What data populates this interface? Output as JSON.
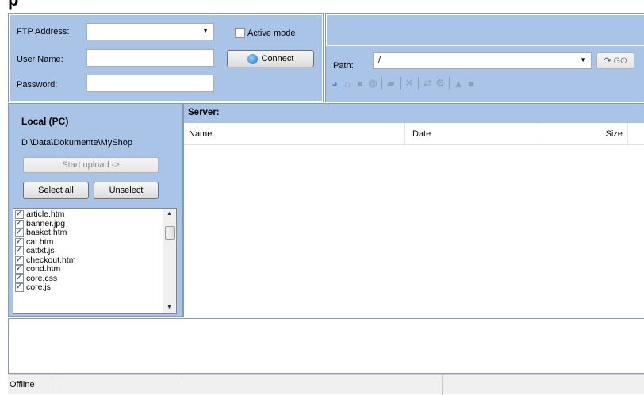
{
  "app": {
    "title_fragment": "p"
  },
  "connection": {
    "ftp_address_label": "FTP Address:",
    "ftp_address_value": "",
    "user_name_label": "User Name:",
    "user_name_value": "",
    "password_label": "Password:",
    "password_value": "",
    "active_mode_label": "Active mode",
    "active_mode_checked": false,
    "connect_label": "Connect"
  },
  "server_toolbar": {
    "path_label": "Path:",
    "path_value": "/",
    "go_label": "GO",
    "icons": [
      "connect-icon",
      "home-icon",
      "record-icon",
      "refresh-icon",
      "new-folder-icon",
      "delete-icon",
      "rename-icon",
      "permissions-icon",
      "upload-icon",
      "stop-icon"
    ]
  },
  "local": {
    "heading": "Local (PC)",
    "path": "D:\\Data\\Dokumente\\MyShop",
    "start_upload_label": "Start upload ->",
    "select_all_label": "Select all",
    "unselect_label": "Unselect",
    "files": [
      {
        "name": "article.htm",
        "checked": true
      },
      {
        "name": "banner.jpg",
        "checked": true
      },
      {
        "name": "basket.htm",
        "checked": true
      },
      {
        "name": "cat.htm",
        "checked": true
      },
      {
        "name": "cattxt.js",
        "checked": true
      },
      {
        "name": "checkout.htm",
        "checked": true
      },
      {
        "name": "cond.htm",
        "checked": true
      },
      {
        "name": "core.css",
        "checked": true
      },
      {
        "name": "core.js",
        "checked": true
      }
    ]
  },
  "server": {
    "heading": "Server:",
    "columns": {
      "name": "Name",
      "date": "Date",
      "size": "Size"
    }
  },
  "status": {
    "text": "Offline"
  }
}
